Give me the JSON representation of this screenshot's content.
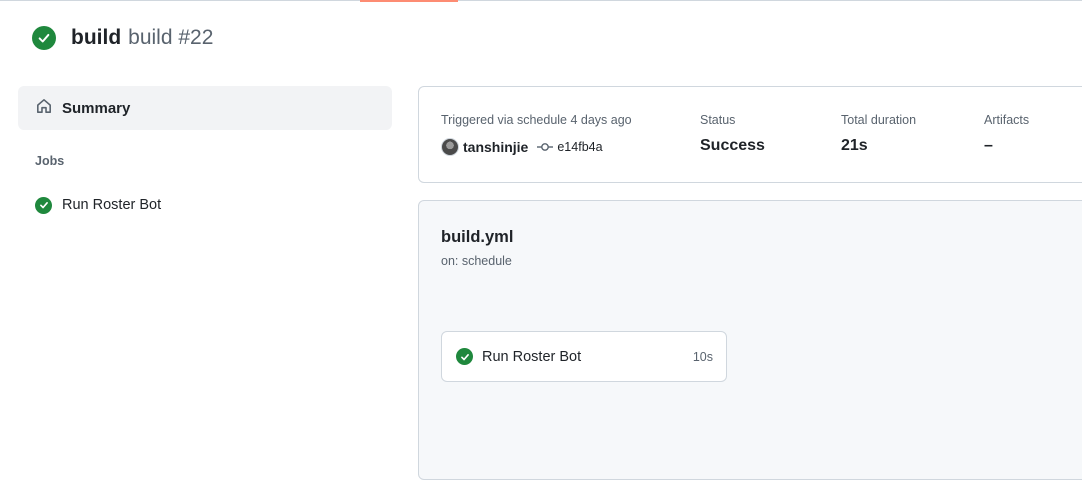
{
  "header": {
    "title": "build",
    "run_label": "build #22"
  },
  "sidebar": {
    "summary_label": "Summary",
    "jobs_heading": "Jobs",
    "jobs": [
      {
        "label": "Run Roster Bot",
        "status": "success"
      }
    ]
  },
  "summary": {
    "trigger_text": "Triggered via schedule 4 days ago",
    "actor": "tanshinjie",
    "commit": "e14fb4a",
    "status_label": "Status",
    "status_value": "Success",
    "duration_label": "Total duration",
    "duration_value": "21s",
    "artifacts_label": "Artifacts",
    "artifacts_value": "–"
  },
  "workflow": {
    "file": "build.yml",
    "trigger": "on: schedule",
    "jobs": [
      {
        "label": "Run Roster Bot",
        "duration": "10s",
        "status": "success"
      }
    ]
  },
  "icons": {
    "success": "check-circle-icon",
    "summary": "home-icon",
    "commit": "git-commit-icon"
  },
  "colors": {
    "success": "#1f883d",
    "muted_text": "#59636e",
    "border": "#d0d7de",
    "accent_tab": "#fd8c73"
  }
}
